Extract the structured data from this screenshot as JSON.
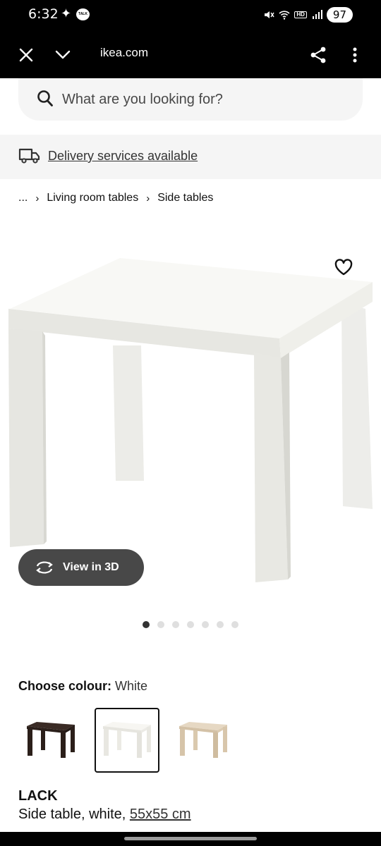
{
  "status_bar": {
    "time": "6:32",
    "sparkle": "✦",
    "talk": "TALK",
    "hd": "HD",
    "battery": "97"
  },
  "browser": {
    "url": "ikea.com",
    "icons": [
      "close-icon",
      "chevron-down-icon",
      "share-icon",
      "more-vertical-icon"
    ]
  },
  "search": {
    "placeholder": "What are you looking for?"
  },
  "delivery": {
    "label": "Delivery services available"
  },
  "breadcrumb": {
    "items": [
      "...",
      "Living room tables",
      "Side tables"
    ]
  },
  "product": {
    "view_3d_label": "View in 3D",
    "image_count": 7,
    "active_image": 1,
    "colour_title": "Choose colour:",
    "colour_value": "White",
    "colours": [
      {
        "name": "black-brown",
        "color": "#2f221d"
      },
      {
        "name": "white",
        "color": "#f4f2ec",
        "selected": true
      },
      {
        "name": "white stained oak effect",
        "color": "#d8c7ae"
      }
    ],
    "name": "LACK",
    "description_prefix": "Side table, white, ",
    "size": "55x55 cm"
  }
}
